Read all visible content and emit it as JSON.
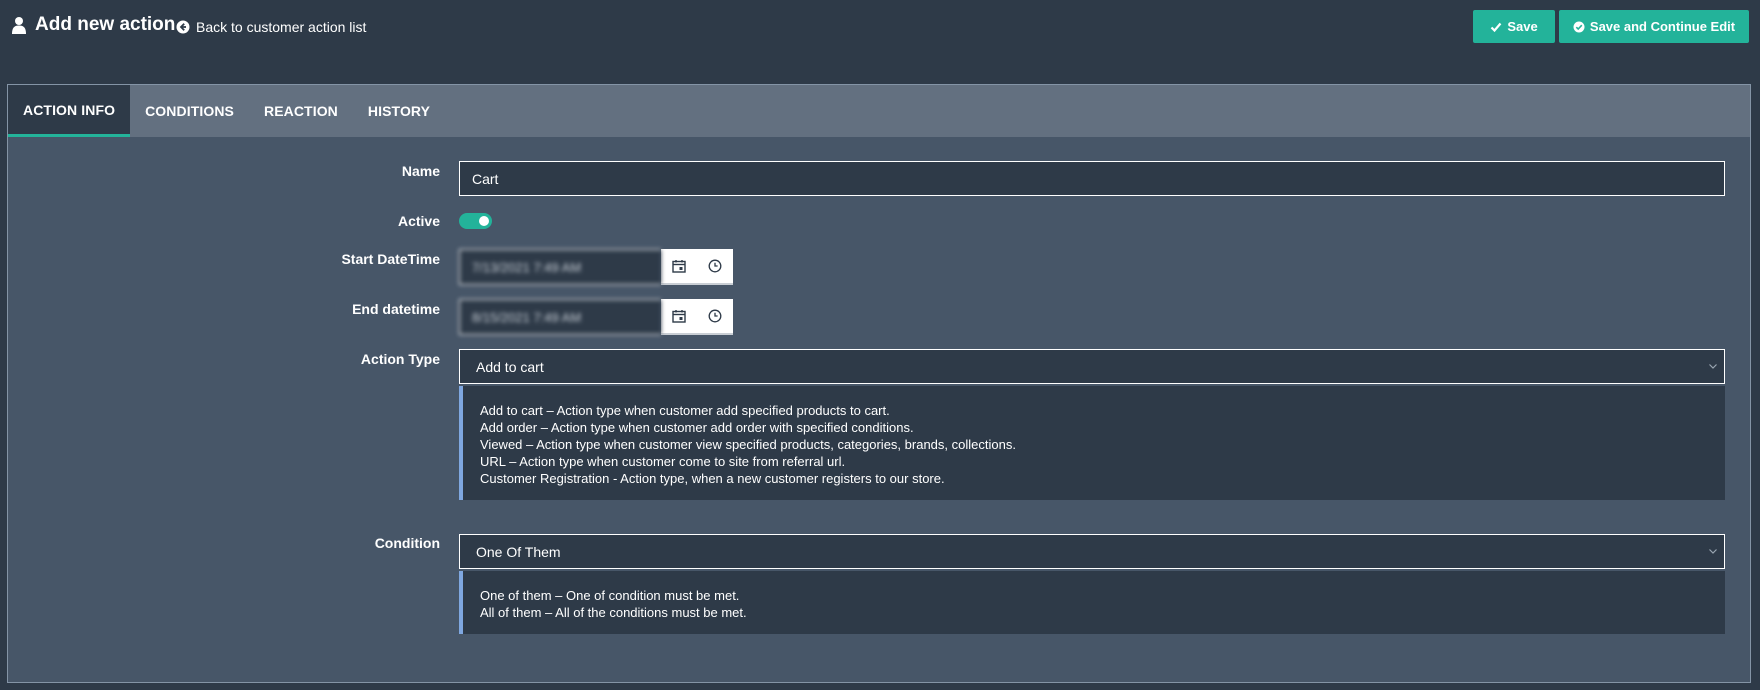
{
  "header": {
    "title": "Add new action",
    "back_link": "Back to customer action list",
    "save_label": "Save",
    "save_continue_label": "Save and Continue Edit"
  },
  "tabs": [
    {
      "label": "ACTION INFO",
      "active": true
    },
    {
      "label": "CONDITIONS",
      "active": false
    },
    {
      "label": "REACTION",
      "active": false
    },
    {
      "label": "HISTORY",
      "active": false
    }
  ],
  "form": {
    "name": {
      "label": "Name",
      "value": "Cart"
    },
    "active": {
      "label": "Active",
      "checked": true
    },
    "start": {
      "label": "Start DateTime",
      "value": "7/13/2021 7:49 AM"
    },
    "end": {
      "label": "End datetime",
      "value": "8/15/2021 7:49 AM"
    },
    "action_type": {
      "label": "Action Type",
      "value": "Add to cart",
      "hints": [
        "Add to cart – Action type when customer add specified products to cart.",
        "Add order – Action type when customer add order with specified conditions.",
        "Viewed – Action type when customer view specified products, categories, brands, collections.",
        "URL – Action type when customer come to site from referral url.",
        "Customer Registration - Action type, when a new customer registers to our store."
      ]
    },
    "condition": {
      "label": "Condition",
      "value": "One Of Them",
      "hints": [
        "One of them – One of condition must be met.",
        "All of them – All of the conditions must be met."
      ]
    }
  },
  "colors": {
    "accent": "#23b39a",
    "background": "#2e3a48",
    "panel": "#475668",
    "tab_bar": "#637080",
    "hint_border": "#7fa7e0"
  },
  "icons": {
    "title": "user-icon",
    "back": "arrow-circle-left-icon",
    "save": "check-icon",
    "save_continue": "check-circle-icon",
    "date": "calendar-icon",
    "time": "clock-icon",
    "select": "chevron-down-icon"
  }
}
